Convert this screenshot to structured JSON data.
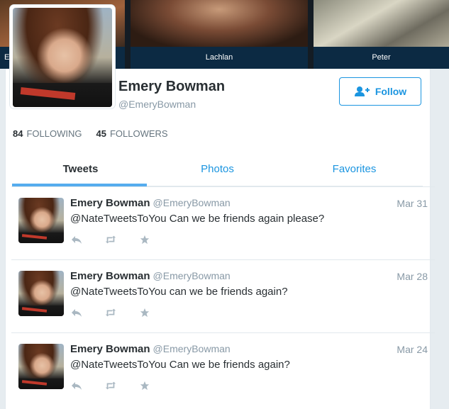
{
  "banner": {
    "captions": [
      "E",
      "Lachlan",
      "Peter"
    ]
  },
  "profile": {
    "name": "Emery Bowman",
    "handle": "@EmeryBowman",
    "follow_label": "Follow",
    "stats": {
      "following_count": "84",
      "following_label": "FOLLOWING",
      "followers_count": "45",
      "followers_label": "FOLLOWERS"
    }
  },
  "tabs": [
    {
      "label": "Tweets",
      "active": true
    },
    {
      "label": "Photos",
      "active": false
    },
    {
      "label": "Favorites",
      "active": false
    }
  ],
  "tweets": [
    {
      "name": "Emery Bowman",
      "handle": "@EmeryBowman",
      "date": "Mar 31",
      "text": "@NateTweetsToYou Can we be friends again please?"
    },
    {
      "name": "Emery Bowman",
      "handle": "@EmeryBowman",
      "date": "Mar 28",
      "text": "@NateTweetsToYou can we be friends again?"
    },
    {
      "name": "Emery Bowman",
      "handle": "@EmeryBowman",
      "date": "Mar 24",
      "text": "@NateTweetsToYou Can we be friends again?"
    }
  ],
  "icons": {
    "follow": "add-user-icon",
    "reply": "reply-icon",
    "retweet": "retweet-icon",
    "favorite": "star-icon"
  },
  "colors": {
    "accent": "#1b95e0",
    "tab_underline": "#55acee",
    "muted": "#8899a6",
    "background": "#e6ecf0"
  }
}
